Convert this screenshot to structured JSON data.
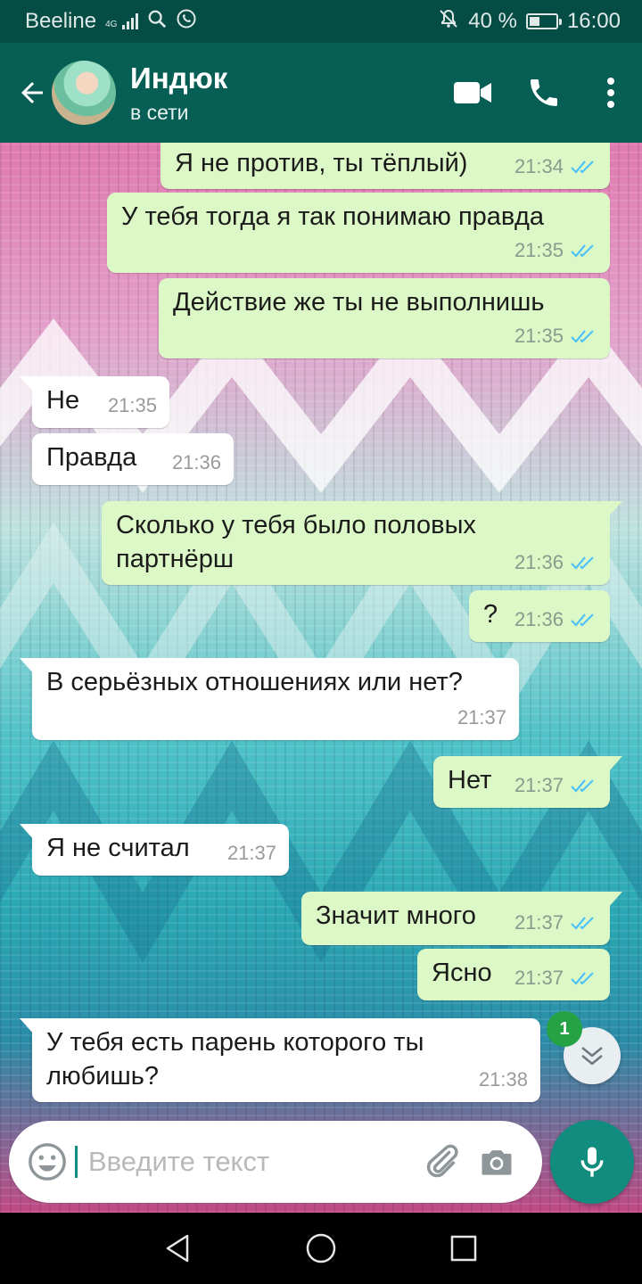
{
  "statusbar": {
    "carrier": "Beeline",
    "network": "4G",
    "battery": "40 %",
    "battery_level": 0.4,
    "time": "16:00"
  },
  "header": {
    "contact_name": "Индюк",
    "contact_status": "в сети",
    "icons": [
      "back-arrow-icon",
      "avatar",
      "video-call-icon",
      "phone-icon",
      "more-vert-icon"
    ]
  },
  "messages": [
    {
      "dir": "out",
      "text": "Я не против, ты тёплый)",
      "time": "21:34",
      "status": "read"
    },
    {
      "dir": "out",
      "text": "У тебя тогда я так понимаю правда",
      "time": "21:35",
      "status": "read"
    },
    {
      "dir": "out",
      "text": "Действие же ты не выполнишь",
      "time": "21:35",
      "status": "read"
    },
    {
      "dir": "in",
      "text": "Не",
      "time": "21:35"
    },
    {
      "dir": "in",
      "text": "Правда",
      "time": "21:36"
    },
    {
      "dir": "out",
      "text": "Сколько у тебя было половых партнёрш",
      "time": "21:36",
      "status": "read"
    },
    {
      "dir": "out",
      "text": "?",
      "time": "21:36",
      "status": "read"
    },
    {
      "dir": "in",
      "text": "В серьёзных отношениях или нет?",
      "time": "21:37"
    },
    {
      "dir": "out",
      "text": "Нет",
      "time": "21:37",
      "status": "read"
    },
    {
      "dir": "in",
      "text": "Я не считал",
      "time": "21:37"
    },
    {
      "dir": "out",
      "text": "Значит много",
      "time": "21:37",
      "status": "read"
    },
    {
      "dir": "out",
      "text": "Ясно",
      "time": "21:37",
      "status": "read"
    },
    {
      "dir": "in",
      "text": "У тебя есть парень которого ты любишь?",
      "time": "21:38"
    }
  ],
  "scroll_down": {
    "unread_count": "1"
  },
  "composer": {
    "placeholder": "Введите текст"
  },
  "colors": {
    "header": "#075e54",
    "statusbar": "#054d44",
    "outgoing_bubble": "#dcf8c6",
    "incoming_bubble": "#ffffff",
    "read_ticks": "#4fc3f7",
    "mic_button": "#128c7e",
    "badge": "#25a244"
  }
}
